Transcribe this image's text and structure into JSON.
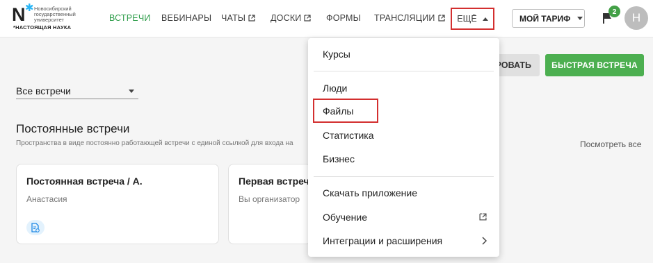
{
  "logo": {
    "letter": "N",
    "university": "Новосибирский государственный университет",
    "tagline": "*НАСТОЯЩАЯ НАУКА"
  },
  "nav": [
    {
      "label": "ВСТРЕЧИ",
      "active": true
    },
    {
      "label": "ВЕБИНАРЫ"
    },
    {
      "label": "ЧАТЫ",
      "external": true
    },
    {
      "label": "ДОСКИ",
      "external": true
    },
    {
      "label": "ФОРМЫ"
    },
    {
      "label": "ТРАНСЛЯЦИИ",
      "external": true
    },
    {
      "label": "ЕЩЁ",
      "expanded": true
    }
  ],
  "header": {
    "plan_label": "МОЙ ТАРИФ",
    "notifications_count": "2",
    "avatar_initial": "Н"
  },
  "toolbar": {
    "schedule_label": "РОВАТЬ",
    "quick_meeting_label": "БЫСТРАЯ ВСТРЕЧА"
  },
  "filter": {
    "selected": "Все встречи"
  },
  "section": {
    "title": "Постоянные встречи",
    "description": "Пространства в виде постоянно работающей встречи с единой ссылкой для входа на",
    "see_all": "Посмотреть все"
  },
  "cards": [
    {
      "title": "Постоянная встреча / А.",
      "subtitle": "Анастасия"
    },
    {
      "title": "Первая встреча",
      "subtitle": "Вы организатор"
    }
  ],
  "menu": {
    "items": [
      {
        "label": "Курсы"
      },
      {
        "label": "Люди"
      },
      {
        "label": "Файлы",
        "highlighted": true
      },
      {
        "label": "Статистика"
      },
      {
        "label": "Бизнес"
      },
      {
        "label": "Скачать приложение"
      },
      {
        "label": "Обучение",
        "icon": "external-link-icon"
      },
      {
        "label": "Интеграции и расширения",
        "icon": "chevron-right-icon"
      }
    ]
  },
  "colors": {
    "accent_green": "#4caf50",
    "active_nav": "#2e9d4a",
    "highlight_red": "#d32f2f",
    "logo_star": "#29b6f6"
  }
}
